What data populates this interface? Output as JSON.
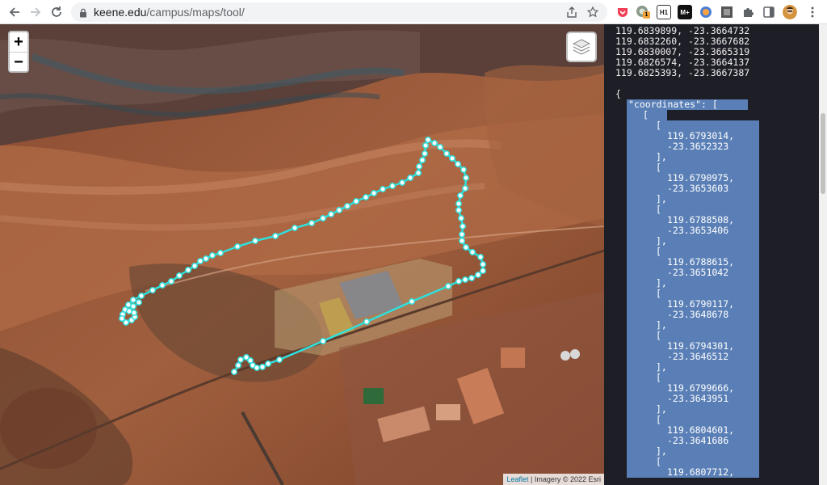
{
  "browser": {
    "url_host": "keene.edu",
    "url_path": "/campus/maps/tool/",
    "extension_badge_count": "1",
    "extensions": [
      "H1",
      "M+"
    ]
  },
  "map": {
    "zoom_in_label": "+",
    "zoom_out_label": "−",
    "attribution_link": "Leaflet",
    "attribution_text": " | Imagery © 2022 Esri",
    "track_color": "#2fe0dc"
  },
  "code": {
    "top_lines": [
      "119.6839899, -23.3664732",
      "119.6832260, -23.3667682",
      "119.6830007, -23.3665319",
      "119.6826574, -23.3664137",
      "119.6825393, -23.3667387"
    ],
    "open_brace": "{",
    "coordinates_key": "\"coordinates\": [",
    "outer_bracket": "[",
    "pairs": [
      [
        "119.6793014,",
        "-23.3652323"
      ],
      [
        "119.6790975,",
        "-23.3653603"
      ],
      [
        "119.6788508,",
        "-23.3653406"
      ],
      [
        "119.6788615,",
        "-23.3651042"
      ],
      [
        "119.6790117,",
        "-23.3648678"
      ],
      [
        "119.6794301,",
        "-23.3646512"
      ],
      [
        "119.6799666,",
        "-23.3643951"
      ],
      [
        "119.6804601,",
        "-23.3641686"
      ]
    ],
    "last_value": "119.6807712,",
    "pair_open": "[",
    "pair_close": "],"
  }
}
